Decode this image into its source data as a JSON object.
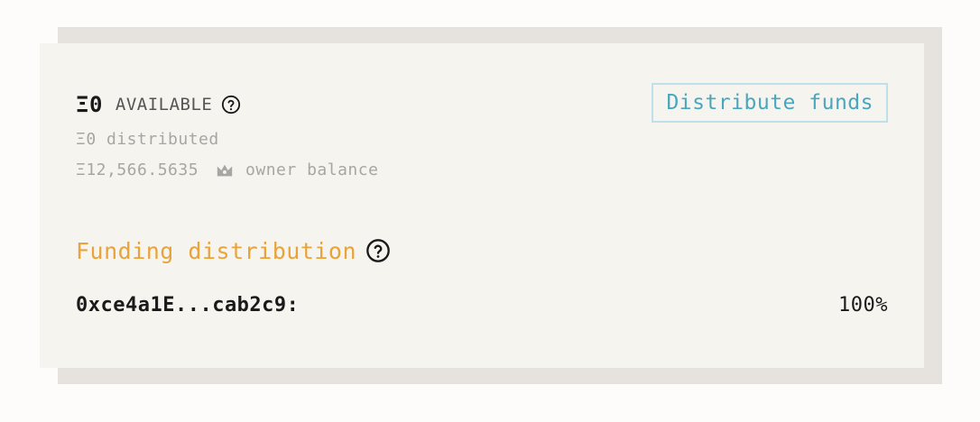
{
  "balance": {
    "available_amount": "Ξ0",
    "available_label": "AVAILABLE",
    "distributed_text": "Ξ0 distributed",
    "owner_amount": "Ξ12,566.5635",
    "owner_label": "owner balance"
  },
  "actions": {
    "distribute_label": "Distribute funds"
  },
  "funding": {
    "title": "Funding distribution",
    "splits": [
      {
        "address": "0xce4a1E...cab2c9:",
        "percent": "100%"
      }
    ]
  },
  "colors": {
    "accent_orange": "#e8a33a",
    "accent_teal": "#4aa6bf",
    "muted_text": "#a7a6a2",
    "card_bg": "#f5f4ef"
  },
  "icons": {
    "help": "help-circle-icon",
    "owner": "crown-icon"
  }
}
